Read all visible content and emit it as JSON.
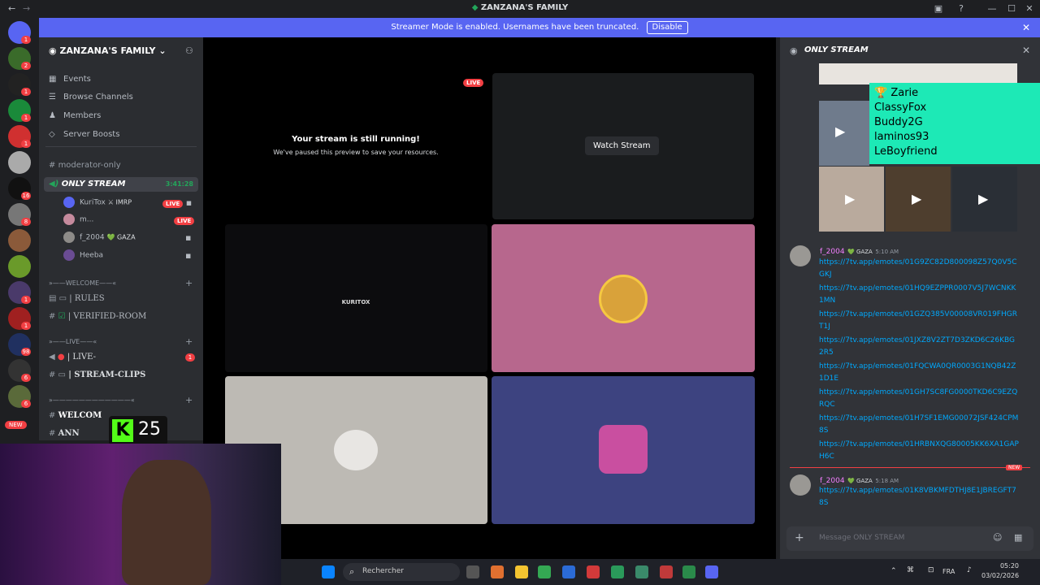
{
  "window": {
    "title": "ZANZANA'S FAMILY"
  },
  "banner": {
    "text": "Streamer Mode is enabled. Usernames have been truncated.",
    "button": "Disable"
  },
  "guild_badges": [
    "1",
    "2",
    "1",
    "1",
    "1",
    "",
    "",
    "16",
    "8",
    "",
    "",
    "1",
    "1",
    "98",
    "6",
    "6",
    "",
    "NEW"
  ],
  "server": {
    "name": "ZANZANA'S FAMILY ⌄"
  },
  "nav": [
    {
      "label": "Events",
      "icon": "calendar-icon"
    },
    {
      "label": "Browse Channels",
      "icon": "browse-icon"
    },
    {
      "label": "Members",
      "icon": "members-icon"
    },
    {
      "label": "Server Boosts",
      "icon": "boost-icon"
    }
  ],
  "channels": {
    "mod": "moderator-only",
    "active": "ONLY STREAM",
    "active_time": "3:41:28"
  },
  "voice_users": [
    {
      "name": "KuriTox",
      "tag": "⚔ IMRP",
      "live": "LIVE",
      "color": "#5865f2"
    },
    {
      "name": "m...",
      "tag": "",
      "live": "LIVE",
      "color": "#c58a9d"
    },
    {
      "name": "f_2004",
      "tag": "💚 GAZA",
      "live": "",
      "color": "#8d8b88"
    },
    {
      "name": "Heeba",
      "tag": "",
      "live": "",
      "color": "#6a4c93"
    }
  ],
  "categories": [
    {
      "label": "»——WELCOME——«"
    },
    {
      "label": "»——LIVE——«"
    },
    {
      "label": "»————————————«"
    }
  ],
  "channels2": {
    "rules": "| RULES",
    "verified": "| VERIFIED-ROOM",
    "live": "| LIVE-",
    "clips": "| STREAM-CLIPS",
    "welcome": "WELCOM",
    "announce": "ANN",
    "live_badge": "1"
  },
  "overlay": {
    "k_count": "25"
  },
  "stage": {
    "live": "LIVE",
    "still_running": "Your stream is still running!",
    "paused": "We've paused this preview to save your resources.",
    "watch": "Watch Stream",
    "kuritox": "KURITOX"
  },
  "chat": {
    "title": "ONLY STREAM",
    "overlay_names": [
      "Zarie",
      "ClassyFox",
      "Buddy2G",
      "laminos93",
      "LeBoyfriend"
    ],
    "msg1": {
      "user": "f_2004",
      "tag": "💚 GAZA",
      "time": "5:10 AM",
      "links": [
        "https://7tv.app/emotes/01G9ZC82D800098Z57Q0V5CGKJ",
        "https://7tv.app/emotes/01HQ9EZPPR0007V5J7WCNKK1MN",
        "https://7tv.app/emotes/01GZQ385V00008VR019FHGRT1J",
        "https://7tv.app/emotes/01JXZ8V2ZT7D3ZKD6C26KBG2R5",
        "https://7tv.app/emotes/01FQCWA0QR0003G1NQB42Z1D1E",
        "https://7tv.app/emotes/01GH7SC8FG0000TKD6C9EZQRQC",
        "https://7tv.app/emotes/01H7SF1EMG00072JSF424CPM8S",
        "https://7tv.app/emotes/01HRBNXQG80005KK6XA1GAPH6C"
      ]
    },
    "new_label": "NEW",
    "msg2": {
      "user": "f_2004",
      "tag": "💚 GAZA",
      "time": "5:18 AM",
      "link": "https://7tv.app/emotes/01K8VBKMFDTHJ8E1JBREGFT78S"
    },
    "input_placeholder": "Message ONLY STREAM"
  },
  "taskbar": {
    "search": "Rechercher",
    "lang": "FRA",
    "time": "05:20",
    "date": "03/02/2026"
  }
}
